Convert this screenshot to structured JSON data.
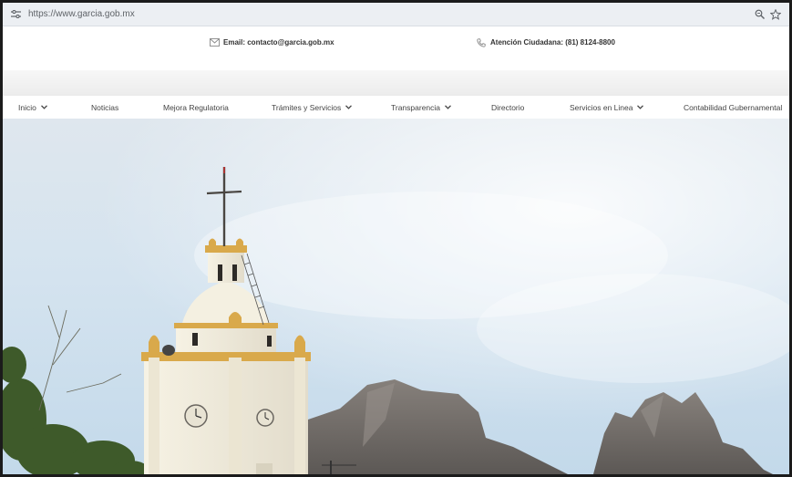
{
  "browser": {
    "url": "https://www.garcia.gob.mx"
  },
  "topbar": {
    "email_label": "Email: contacto@garcia.gob.mx",
    "phone_label": "Atención Ciudadana: (81) 8124-8800"
  },
  "nav": {
    "items": [
      {
        "label": "Inicio",
        "dropdown": true
      },
      {
        "label": "Noticias",
        "dropdown": false
      },
      {
        "label": "Mejora Regulatoria",
        "dropdown": false
      },
      {
        "label": "Trámites y Servicios",
        "dropdown": true
      },
      {
        "label": "Transparencia",
        "dropdown": true
      },
      {
        "label": "Directorio",
        "dropdown": false
      },
      {
        "label": "Servicios en Linea",
        "dropdown": true
      },
      {
        "label": "Contabilidad Gubernamental",
        "dropdown": false
      }
    ]
  },
  "icons": {
    "site_info": "tune-icon",
    "zoom": "magnifier-icon",
    "bookmark": "star-icon",
    "email": "envelope-icon",
    "phone": "phone-icon",
    "dropdown": "chevron-down-icon"
  },
  "colors": {
    "sky": "#cfe1ef",
    "church": "#f1ecdb",
    "church_trim": "#d9a94b",
    "mountain": "#6f6a66"
  }
}
